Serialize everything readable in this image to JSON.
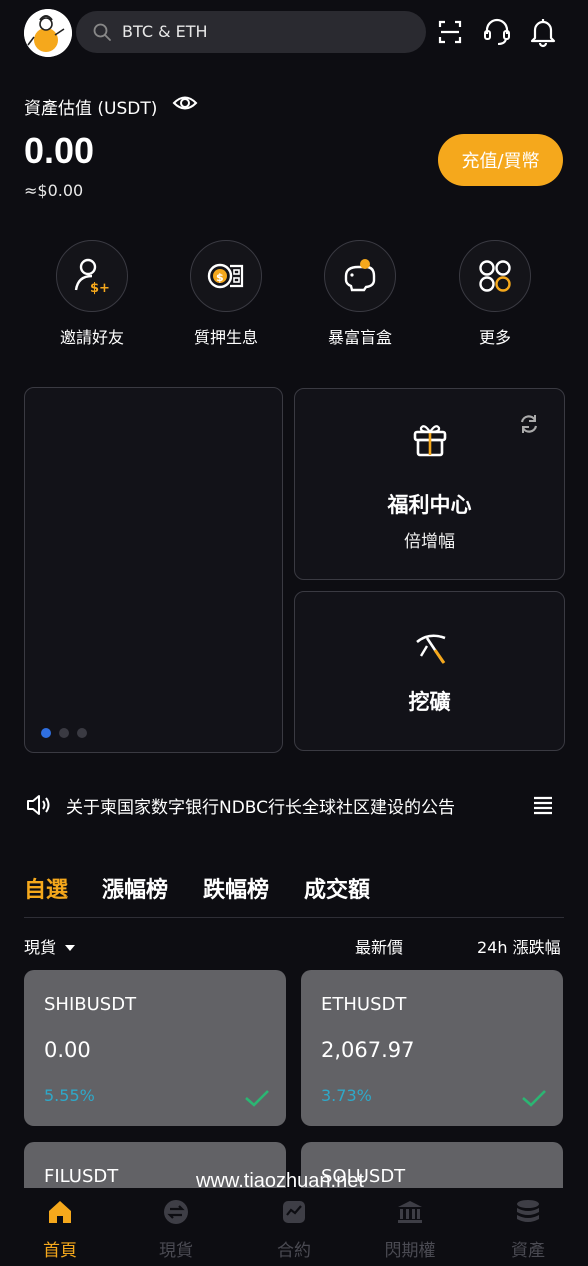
{
  "header": {
    "search_text": "BTC & ETH"
  },
  "assets": {
    "label": "資產估值 (USDT)",
    "value": "0.00",
    "usd_value": "≈$0.00",
    "deposit_button": "充值/買幣"
  },
  "quick_actions": [
    {
      "label": "邀請好友",
      "icon": "invite-friend-icon"
    },
    {
      "label": "質押生息",
      "icon": "staking-icon"
    },
    {
      "label": "暴富盲盒",
      "icon": "piggy-bank-icon"
    },
    {
      "label": "更多",
      "icon": "more-grid-icon"
    }
  ],
  "welfare": {
    "title": "福利中心",
    "subtitle": "倍增幅"
  },
  "mining": {
    "title": "挖礦"
  },
  "notice": {
    "text": "关于柬国家数字银行NDBC行长全球社区建设的公告"
  },
  "market_tabs": [
    "自選",
    "漲幅榜",
    "跌幅榜",
    "成交額"
  ],
  "columns": {
    "spot": "現貨",
    "price": "最新價",
    "change": "24h 漲跌幅"
  },
  "cards": [
    {
      "symbol": "SHIBUSDT",
      "price": "0.00",
      "change": "5.55%"
    },
    {
      "symbol": "ETHUSDT",
      "price": "2,067.97",
      "change": "3.73%"
    },
    {
      "symbol": "FILUSDT",
      "price": "",
      "change": ""
    },
    {
      "symbol": "SOLUSDT",
      "price": "",
      "change": ""
    }
  ],
  "bottom_nav": [
    {
      "label": "首頁",
      "icon": "home-icon"
    },
    {
      "label": "現貨",
      "icon": "spot-exchange-icon"
    },
    {
      "label": "合約",
      "icon": "contract-chart-icon"
    },
    {
      "label": "閃期權",
      "icon": "bank-icon"
    },
    {
      "label": "資產",
      "icon": "coins-stack-icon"
    }
  ],
  "watermark": "www.tiaozhuan.net",
  "colors": {
    "accent": "#f5a81c",
    "positive": "#2fa8c8",
    "check": "#2bb673"
  }
}
